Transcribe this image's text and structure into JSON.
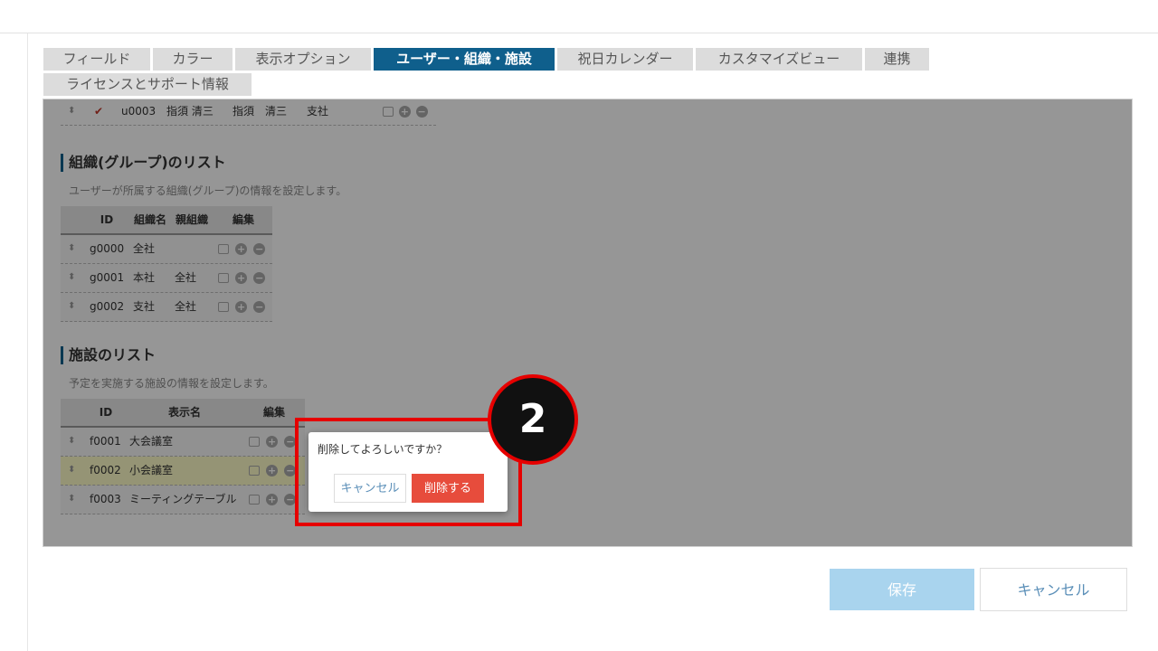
{
  "tabs": [
    {
      "label": "フィールド",
      "active": false
    },
    {
      "label": "カラー",
      "active": false
    },
    {
      "label": "表示オプション",
      "active": false
    },
    {
      "label": "ユーザー・組織・施設",
      "active": true
    },
    {
      "label": "祝日カレンダー",
      "active": false
    },
    {
      "label": "カスタマイズビュー",
      "active": false
    },
    {
      "label": "連携",
      "active": false
    },
    {
      "label": "ライセンスとサポート情報",
      "active": false
    }
  ],
  "user_row": {
    "id": "u0003",
    "name": "指須 清三",
    "display": "指須　清三",
    "group": "支社"
  },
  "groups": {
    "title": "組織(グループ)のリスト",
    "desc": "ユーザーが所属する組織(グループ)の情報を設定します。",
    "headers": [
      "ID",
      "組織名",
      "親組織",
      "編集"
    ],
    "rows": [
      {
        "id": "g0000",
        "name": "全社",
        "parent": ""
      },
      {
        "id": "g0001",
        "name": "本社",
        "parent": "全社"
      },
      {
        "id": "g0002",
        "name": "支社",
        "parent": "全社"
      }
    ]
  },
  "facilities": {
    "title": "施設のリスト",
    "desc": "予定を実施する施設の情報を設定します。",
    "headers": [
      "ID",
      "表示名",
      "編集"
    ],
    "rows": [
      {
        "id": "f0001",
        "name": "大会議室"
      },
      {
        "id": "f0002",
        "name": "小会議室"
      },
      {
        "id": "f0003",
        "name": "ミーティングテーブル"
      }
    ]
  },
  "dialog": {
    "message": "削除してよろしいですか？",
    "cancel": "キャンセル",
    "delete": "削除する"
  },
  "badge": "2",
  "footer": {
    "save": "保存",
    "cancel": "キャンセル"
  },
  "colors": {
    "accent": "#0f5f8c",
    "danger": "#e74c3c",
    "highlight_red": "#e60000",
    "save_bg": "#a9d4ee"
  },
  "icons": [
    "sort-icon",
    "check-icon",
    "edit-icon",
    "plus-circle-icon",
    "minus-circle-icon"
  ]
}
